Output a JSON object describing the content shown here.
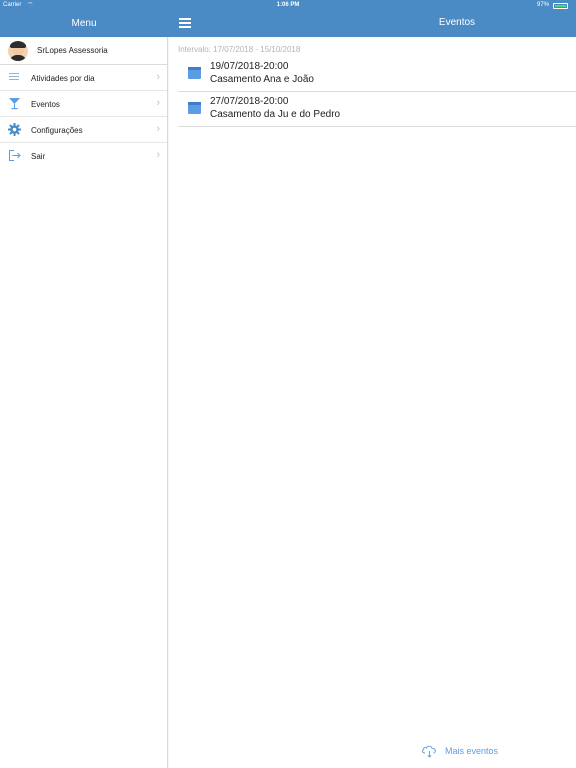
{
  "status_bar": {
    "carrier": "Carrier",
    "time": "1:06 PM",
    "battery_percent": "97%"
  },
  "sidebar": {
    "title": "Menu",
    "profile_name": "SrLopes Assessoria",
    "items": [
      {
        "label": "Atividades por dia",
        "icon": "list-icon"
      },
      {
        "label": "Eventos",
        "icon": "cocktail-glass-icon"
      },
      {
        "label": "Configurações",
        "icon": "gear-icon"
      },
      {
        "label": "Sair",
        "icon": "logout-icon"
      }
    ]
  },
  "main": {
    "title": "Eventos",
    "interval": "Intervalo: 17/07/2018 - 15/10/2018",
    "events": [
      {
        "date": "19/07/2018-20:00",
        "name": "Casamento Ana e João"
      },
      {
        "date": "27/07/2018-20:00",
        "name": "Casamento da Ju e do Pedro"
      }
    ],
    "more_label": "Mais eventos"
  },
  "colors": {
    "nav_blue": "#4a8bc5",
    "accent_blue": "#5b9de3",
    "battery_green": "#4cd964"
  }
}
